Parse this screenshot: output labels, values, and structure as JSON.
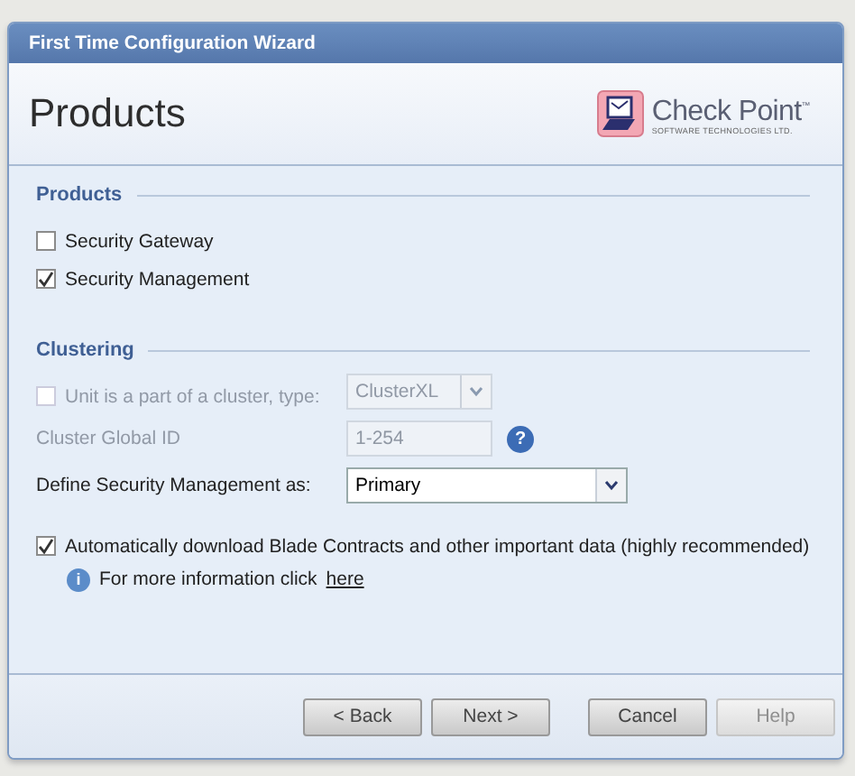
{
  "window": {
    "title": "First Time Configuration Wizard"
  },
  "header": {
    "title": "Products",
    "logo": {
      "name": "Check Point",
      "trademark": "™",
      "tagline": "SOFTWARE TECHNOLOGIES LTD."
    }
  },
  "products": {
    "title": "Products",
    "options": [
      {
        "label": "Security Gateway",
        "checked": false
      },
      {
        "label": "Security Management",
        "checked": true
      }
    ]
  },
  "clustering": {
    "title": "Clustering",
    "cluster_member": {
      "label": "Unit is a part of a cluster, type:",
      "checked": false,
      "disabled": true
    },
    "cluster_type": {
      "value": "ClusterXL",
      "disabled": true
    },
    "global_id": {
      "label": "Cluster Global ID",
      "placeholder": "1-254",
      "disabled": true,
      "help_glyph": "?"
    },
    "management_role": {
      "label": "Define Security Management as:",
      "value": "Primary"
    }
  },
  "auto_download": {
    "label": "Automatically download Blade Contracts and other important data (highly recommended)",
    "checked": true
  },
  "info": {
    "glyph": "i",
    "text": "For more information click",
    "link": "here"
  },
  "buttons": [
    {
      "label": "< Back",
      "disabled": false
    },
    {
      "label": "Next >",
      "disabled": false
    },
    {
      "label": "Cancel",
      "disabled": false
    },
    {
      "label": "Help",
      "disabled": true
    }
  ]
}
